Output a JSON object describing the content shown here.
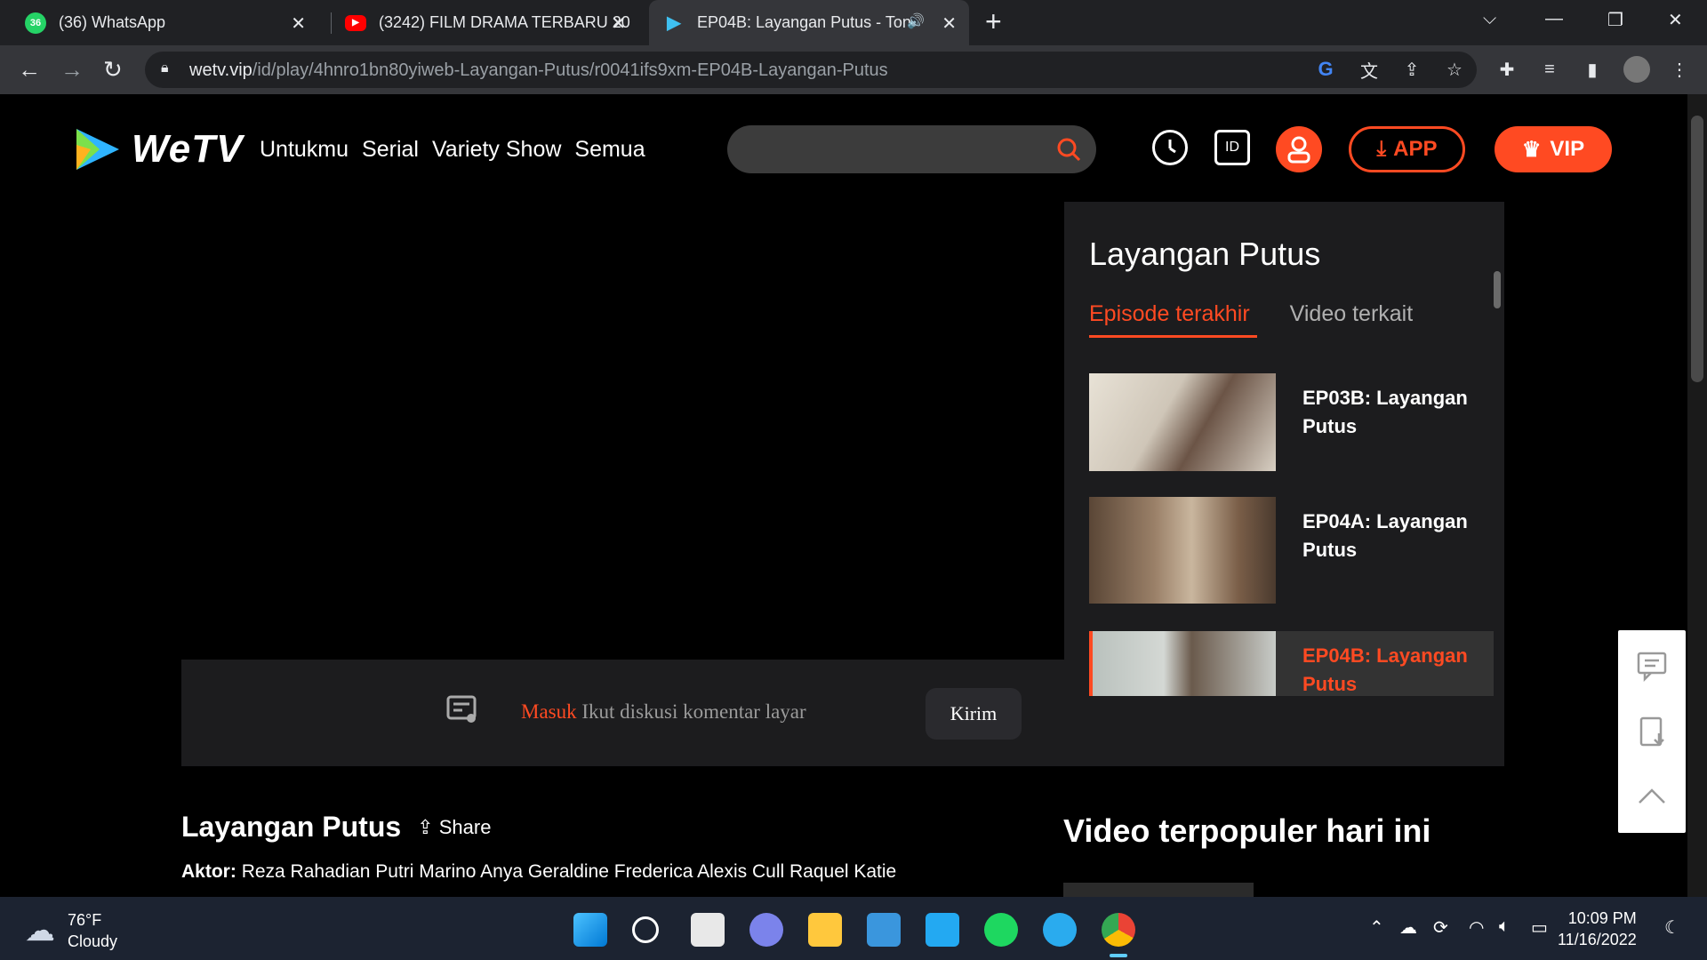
{
  "browser": {
    "tabs": [
      {
        "title": "(36) WhatsApp",
        "badge": "36",
        "icon": "whatsapp-icon"
      },
      {
        "title": "(3242) FILM DRAMA TERBARU 20",
        "icon": "youtube-icon"
      },
      {
        "title": "EP04B: Layangan Putus - Ton",
        "icon": "wetv-icon",
        "audio": "🔊"
      }
    ],
    "new_tab": "+",
    "url_host": "wetv.vip",
    "url_path": "/id/play/4hnro1bn80yiweb-Layangan-Putus/r0041ifs9xm-EP04B-Layangan-Putus"
  },
  "site": {
    "logo": "WeTV",
    "nav": [
      "Untukmu",
      "Serial",
      "Variety Show",
      "Semua"
    ],
    "id_label": "ID",
    "app_label": "APP",
    "vip_label": "VIP"
  },
  "comment": {
    "login": "Masuk",
    "placeholder": "Ikut diskusi komentar layar",
    "send": "Kirim"
  },
  "sidebar": {
    "title": "Layangan Putus",
    "tabs": [
      "Episode terakhir",
      "Video terkait"
    ],
    "episodes": [
      {
        "line1": "EP03B: Layangan",
        "line2": "Putus"
      },
      {
        "line1": "EP04A: Layangan",
        "line2": "Putus"
      },
      {
        "line1": "EP04B: Layangan",
        "line2": "Putus"
      }
    ]
  },
  "info": {
    "title": "Layangan Putus",
    "share": "Share",
    "actors_label": "Aktor:",
    "actors": "Reza Rahadian Putri Marino Anya Geraldine Frederica Alexis Cull Raquel Katie"
  },
  "popular": {
    "title": "Video terpopuler hari ini"
  },
  "taskbar": {
    "temp": "76°F",
    "condition": "Cloudy",
    "time": "10:09 PM",
    "date": "11/16/2022"
  },
  "colors": {
    "accent": "#ff4a22",
    "bg": "#000000",
    "panel": "#1c1c1e"
  }
}
